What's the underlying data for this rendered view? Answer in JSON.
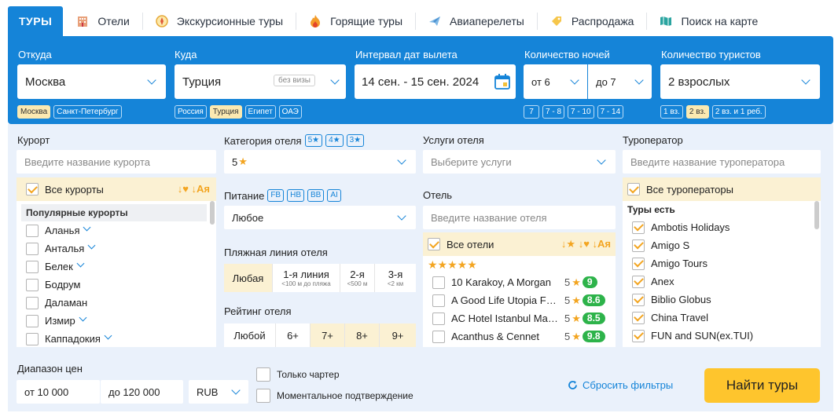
{
  "tabs": [
    {
      "label": "ТУРЫ",
      "icon": ""
    },
    {
      "label": "Отели",
      "icon": "hotel-icon"
    },
    {
      "label": "Экскурсионные туры",
      "icon": "compass-icon"
    },
    {
      "label": "Горящие туры",
      "icon": "fire-icon"
    },
    {
      "label": "Авиаперелеты",
      "icon": "plane-icon"
    },
    {
      "label": "Распродажа",
      "icon": "tag-icon"
    },
    {
      "label": "Поиск на карте",
      "icon": "map-icon"
    }
  ],
  "search": {
    "from_label": "Откуда",
    "from_value": "Москва",
    "from_chips": [
      "Москва",
      "Санкт-Петербург"
    ],
    "to_label": "Куда",
    "to_value": "Турция",
    "to_visa": "без визы",
    "to_chips": [
      "Россия",
      "Турция",
      "Египет",
      "ОАЭ"
    ],
    "dates_label": "Интервал дат вылета",
    "dates_value": "14 сен. - 15 сен. 2024",
    "nights_label": "Количество ночей",
    "nights_from": "от 6",
    "nights_to": "до 7",
    "nights_chips": [
      "7",
      "7 - 8",
      "7 - 10",
      "7 - 14"
    ],
    "tourists_label": "Количество туристов",
    "tourists_value": "2 взрослых",
    "tourists_chips": [
      "1 вз.",
      "2 вз.",
      "2 вз. и 1 реб."
    ]
  },
  "resort": {
    "label": "Курорт",
    "placeholder": "Введите название курорта",
    "all": "Все курорты",
    "sort_icons": "↓♥ ↓Ая",
    "popular": "Популярные курорты",
    "items": [
      "Аланья",
      "Анталья",
      "Белек",
      "Бодрум",
      "Даламан",
      "Измир",
      "Каппадокия"
    ]
  },
  "category": {
    "label": "Категория отеля",
    "badges": [
      "5★",
      "4★",
      "3★"
    ],
    "value": "5",
    "star": "★"
  },
  "meal": {
    "label": "Питание",
    "badges": [
      "FB",
      "HB",
      "BB",
      "AI"
    ],
    "value": "Любое"
  },
  "beach": {
    "label": "Пляжная линия отеля",
    "options": [
      {
        "main": "Любая",
        "sub": ""
      },
      {
        "main": "1-я линия",
        "sub": "<100 м до пляжа"
      },
      {
        "main": "2-я",
        "sub": "<500 м"
      },
      {
        "main": "3-я",
        "sub": "<2 км"
      }
    ]
  },
  "rating": {
    "label": "Рейтинг отеля",
    "options": [
      "Любой",
      "6+",
      "7+",
      "8+",
      "9+"
    ]
  },
  "services": {
    "label": "Услуги отеля",
    "placeholder": "Выберите услуги"
  },
  "hotel": {
    "label": "Отель",
    "placeholder": "Введите название отеля",
    "all": "Все отели",
    "sort_icons": "↓★ ↓♥ ↓Ая",
    "stars_row": "★★★★★",
    "items": [
      {
        "name": "10 Karakoy, A Morgan",
        "stars": "5",
        "score": "9"
      },
      {
        "name": "A Good Life Utopia Family",
        "stars": "5",
        "score": "8.6"
      },
      {
        "name": "AC Hotel Istanbul Macka",
        "stars": "5",
        "score": "8.5"
      },
      {
        "name": "Acanthus & Cennet",
        "stars": "5",
        "score": "9.8"
      }
    ]
  },
  "operator": {
    "label": "Туроператор",
    "placeholder": "Введите название туроператора",
    "all": "Все туроператоры",
    "sub": "Туры есть",
    "items": [
      "Ambotis Holidays",
      "Amigo S",
      "Amigo Tours",
      "Anex",
      "Biblio Globus",
      "China Travel",
      "FUN and SUN(ex.TUI)"
    ]
  },
  "price": {
    "label": "Диапазон цен",
    "from": "от 10 000",
    "to": "до 120 000",
    "currency": "RUB"
  },
  "options": {
    "charter": "Только чартер",
    "instant": "Моментальное подтверждение"
  },
  "actions": {
    "reset": "Сбросить фильтры",
    "find": "Найти туры"
  },
  "colors": {
    "brand": "#1584d8",
    "accent": "#fec52d",
    "highlight": "#fbf1d3",
    "score": "#2db34a"
  }
}
